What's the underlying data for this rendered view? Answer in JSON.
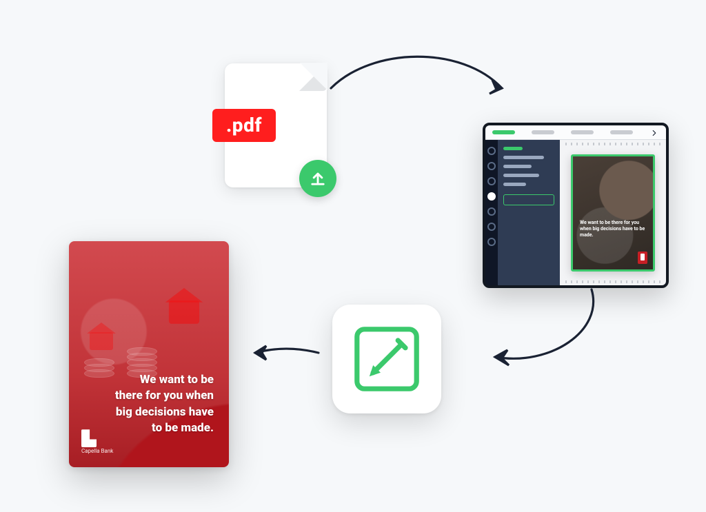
{
  "diagram": {
    "type": "process-flow",
    "steps": [
      "upload-pdf",
      "edit-in-app",
      "design-tool",
      "final-output"
    ]
  },
  "pdf": {
    "extension_label": ".pdf"
  },
  "editor": {
    "thumb_copy": "We want to be there for you when big decisions have to be made."
  },
  "output": {
    "copy": "We want to be there for you when big decisions have to be made.",
    "brand_name": "Capella Bank"
  },
  "colors": {
    "accent_green": "#3bc96c",
    "accent_red": "#ff1e1e",
    "editor_dark": "#17233a",
    "output_red": "#b0151c"
  }
}
